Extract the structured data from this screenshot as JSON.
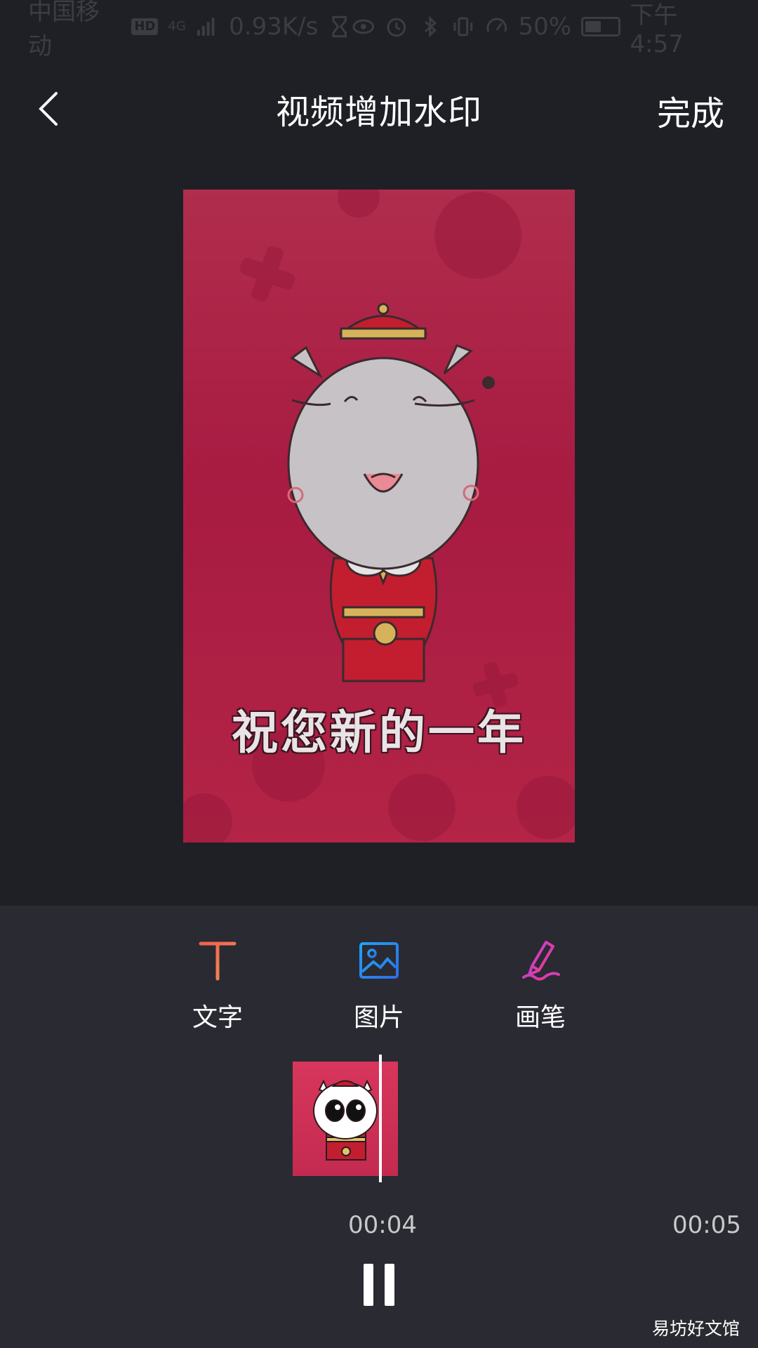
{
  "status_bar": {
    "carrier": "中国移动",
    "hd_badge": "HD",
    "network": "4G",
    "speed": "0.93K/s",
    "battery": "50%",
    "time": "下午4:57",
    "icons": [
      "hourglass-icon",
      "eye-icon",
      "alarm-icon",
      "bluetooth-icon",
      "vibrate-icon",
      "speed-icon",
      "battery-icon"
    ]
  },
  "header": {
    "title": "视频增加水印",
    "done_label": "完成",
    "back_icon": "chevron-left-icon"
  },
  "preview": {
    "caption": "祝您新的一年"
  },
  "tools": [
    {
      "label": "文字",
      "icon": "text-icon",
      "color": "#f25c4e"
    },
    {
      "label": "图片",
      "icon": "image-icon",
      "color": "#1f8ef0"
    },
    {
      "label": "画笔",
      "icon": "brush-icon",
      "color": "#d93fb0"
    }
  ],
  "timeline": {
    "current_time": "00:04",
    "total_time": "00:05"
  },
  "playback": {
    "state": "playing",
    "button_icon": "pause-icon"
  },
  "watermark_text": "易坊好文馆",
  "colors": {
    "background": "#1f2026",
    "panel": "#2a2a32",
    "video_bg": "#a81b42"
  }
}
